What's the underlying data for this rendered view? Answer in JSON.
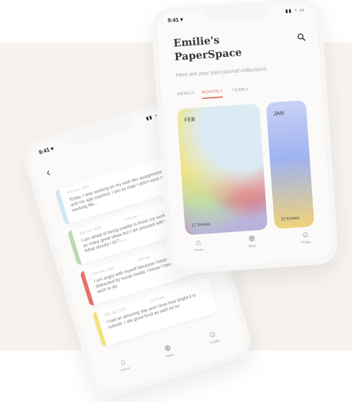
{
  "left_phone": {
    "status_time": "9:41",
    "status_arrow": "▾",
    "status_icons": "▮▮ ◔ ▭",
    "entries": [
      {
        "date": "20th Jan, 2020",
        "time": "",
        "text": "Today, I was working on my web dev assignment and my app crashed. I am so mad I didn't save my working file...",
        "color": "#cfe6f5"
      },
      {
        "date": "30th Jan, 2020",
        "time": "5:00 pm",
        "text": "I am afraid of being unable to finish my work. I have so many great ideas but I am pressed with time. What should I do?......",
        "color": "#bcd9b0"
      },
      {
        "date": "15th Feb, 2020",
        "time": "9:00 am",
        "text": "I am angry with myself because I keep getting distracted by social media. I know I have so much work to do",
        "color": "#e7706a"
      },
      {
        "date": "26th Jan, 2020",
        "time": "10:00 am",
        "text": "I had an amazing day and I love how bright it is outside. I ate good food as well! lol lol",
        "color": "#f1e37b"
      }
    ],
    "tabs": [
      {
        "label": "Home",
        "icon": "home-icon",
        "glyph": "⌂"
      },
      {
        "label": "Write",
        "icon": "plus-icon",
        "glyph": "⊕"
      },
      {
        "label": "Profile",
        "icon": "user-icon",
        "glyph": "☺"
      }
    ]
  },
  "right_phone": {
    "status_time": "9:41",
    "status_arrow": "▾",
    "status_icons": "▮▮ ◔ ▭",
    "title": "Emilie's PaperSpace",
    "subtitle": "Here are your past journal collections.",
    "segments": [
      "WEEKLY",
      "MONTHLY",
      "YEARLY"
    ],
    "active_segment": "MONTHLY",
    "cards": [
      {
        "month": "FEB",
        "entries": "17 Entries"
      },
      {
        "month": "JAN",
        "entries": "22 Entries"
      }
    ],
    "tabs": [
      {
        "label": "Home",
        "icon": "home-icon",
        "glyph": "⌂"
      },
      {
        "label": "Write",
        "icon": "plus-icon",
        "glyph": "⊕"
      },
      {
        "label": "Profile",
        "icon": "user-icon",
        "glyph": "☺"
      }
    ]
  },
  "colors": {
    "accent": "#e0715f",
    "backdrop": "#f8f3ef",
    "entry_blue": "#cfe6f5",
    "entry_green": "#bcd9b0",
    "entry_red": "#e7706a",
    "entry_yellow": "#f1e37b"
  }
}
